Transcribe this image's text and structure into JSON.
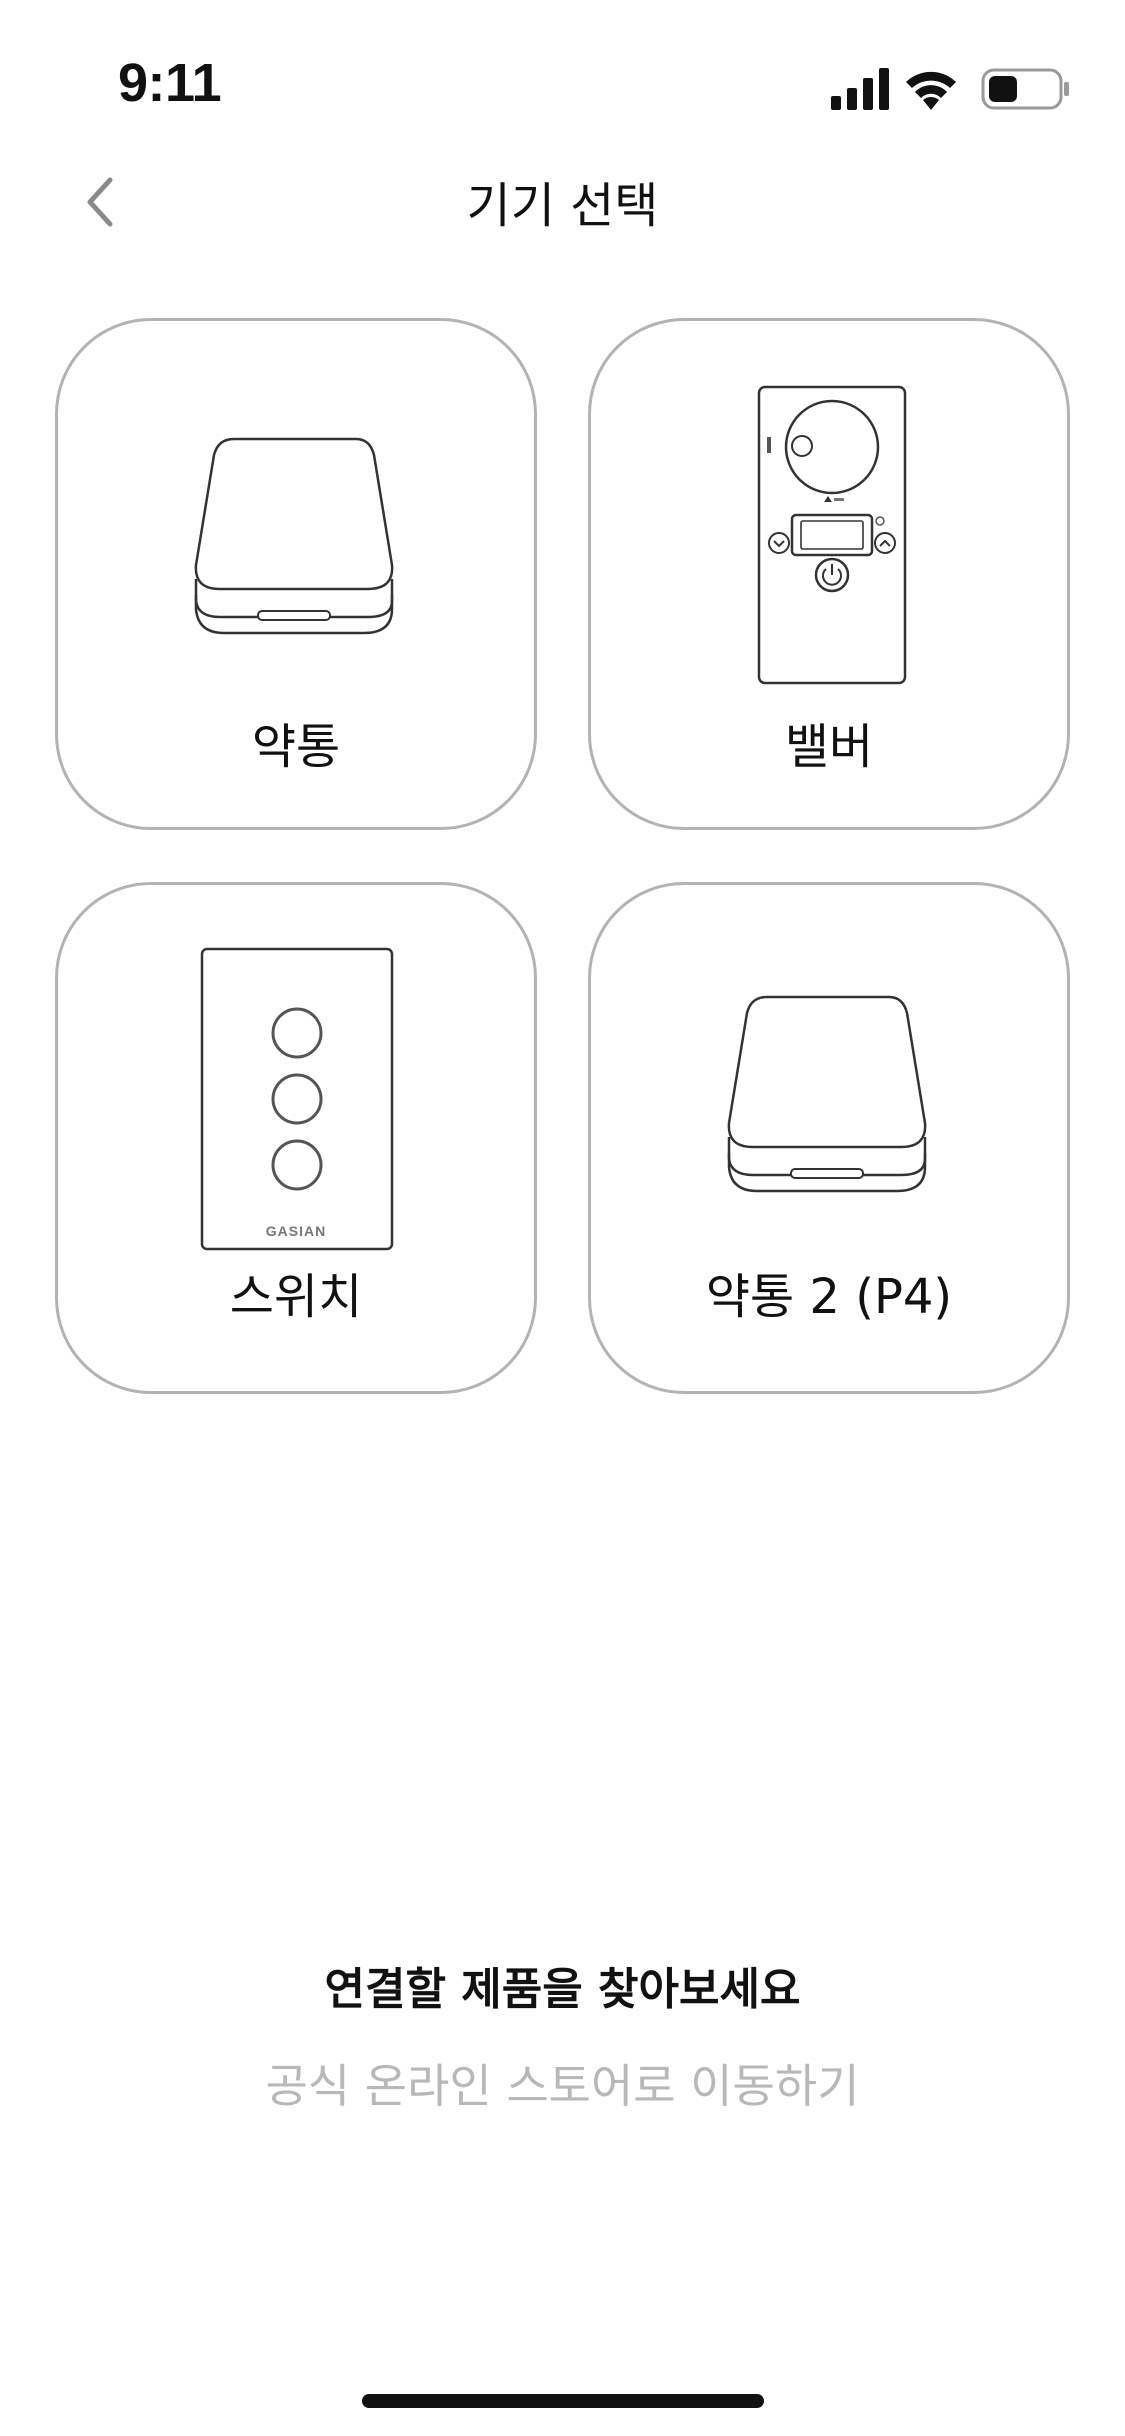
{
  "status_bar": {
    "time": "9:11",
    "icons": [
      "signal-icon",
      "wifi-icon",
      "battery-icon"
    ]
  },
  "header": {
    "title": "기기 선택",
    "back_icon": "chevron-left-icon"
  },
  "devices": [
    {
      "label": "약통",
      "icon": "pill-box-icon"
    },
    {
      "label": "밸버",
      "icon": "valve-controller-icon"
    },
    {
      "label": "스위치",
      "icon": "wall-switch-icon",
      "brand_text": "GASIAN"
    },
    {
      "label": "약통 2 (P4)",
      "icon": "pill-box-icon"
    }
  ],
  "promo": {
    "heading": "연결할 제품을 찾아보세요",
    "link": "공식 온라인 스토어로 이동하기"
  },
  "colors": {
    "card_border": "#b3b3b3",
    "text": "#111111",
    "muted_link": "#b8b8b8"
  }
}
